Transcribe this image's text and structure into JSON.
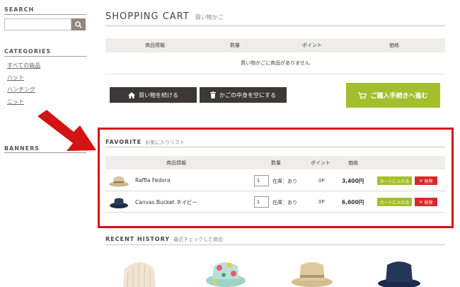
{
  "sidebar": {
    "search_heading": "SEARCH",
    "search_placeholder": "",
    "categories_heading": "CATEGORIES",
    "categories": [
      "すべての商品",
      "ハット",
      "ハンチング",
      "ニット"
    ],
    "banners_heading": "BANNERS"
  },
  "cart": {
    "title": "SHOPPING CART",
    "subtitle": "買い物かご",
    "columns": [
      "商品情報",
      "数量",
      "ポイント",
      "価格"
    ],
    "empty_message": "買い物かごに商品がありません",
    "continue_label": "買い物を続ける",
    "clear_label": "かごの中身を空にする",
    "checkout_label": "ご購入手続きへ進む"
  },
  "favorite": {
    "title": "FAVORITE",
    "subtitle": "お気に入りリスト",
    "columns": [
      "商品情報",
      "数量",
      "ポイント",
      "価格"
    ],
    "items": [
      {
        "name": "Raffia Fedora",
        "qty": "1",
        "stock": "在庫：あり",
        "points": "0P",
        "price": "3,400円",
        "add_label": "カートに入れる",
        "delete_label": "削除",
        "thumb_icon": "straw-fedora-icon"
      },
      {
        "name": "Canvas Bucket ネイビー",
        "qty": "1",
        "stock": "在庫：あり",
        "points": "0P",
        "price": "6,600円",
        "add_label": "カートに入れる",
        "delete_label": "削除",
        "thumb_icon": "navy-bucket-hat-icon"
      }
    ]
  },
  "recent": {
    "title": "RECENT HISTORY",
    "subtitle": "最近チェックした商品",
    "items": [
      "cream-knit-beanie-icon",
      "floral-bucket-hat-icon",
      "straw-fedora-icon",
      "navy-bucket-hat-icon"
    ]
  },
  "colors": {
    "highlight": "#d21414",
    "accent_green": "#a3bf2e",
    "dark_button": "#3b3835",
    "delete_red": "#d62a2a"
  }
}
